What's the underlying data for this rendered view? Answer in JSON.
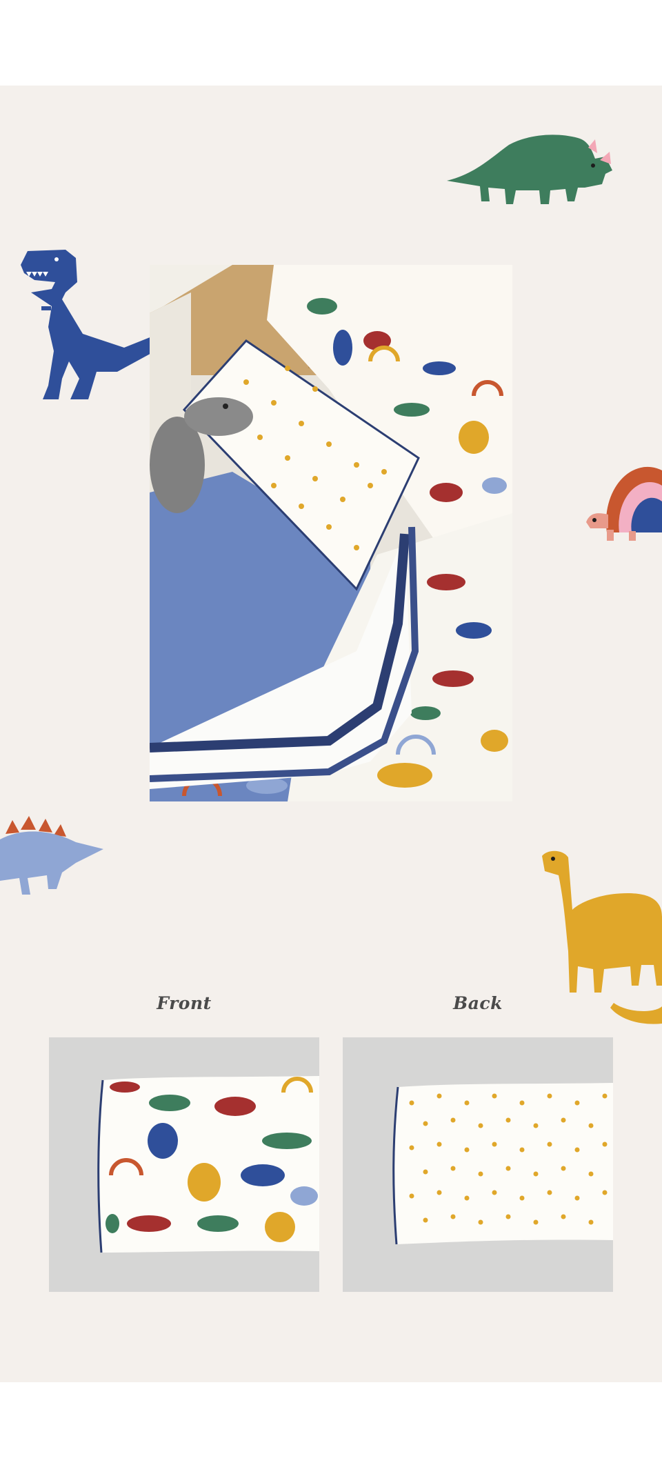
{
  "product_views": {
    "front_label": "Front",
    "back_label": "Back"
  },
  "icons": {
    "decor": [
      "t-rex-icon",
      "triceratops-icon",
      "rainbow-turtle-icon",
      "stegosaurus-icon",
      "brontosaurus-icon"
    ]
  },
  "colors": {
    "background_panel": "#f4f0ec",
    "page": "#ffffff",
    "navy": "#2f4f9a",
    "green": "#3e7d5d",
    "red": "#a5302f",
    "mustard": "#e0a72a",
    "periwinkle": "#8fa6d4",
    "sheet_blue": "#6b86c0"
  }
}
